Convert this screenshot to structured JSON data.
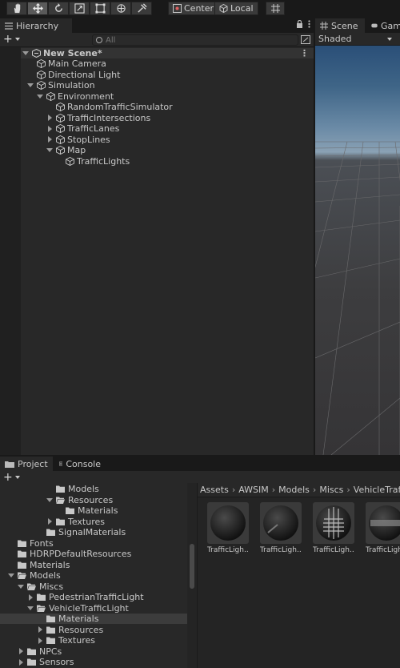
{
  "toolbar": {
    "tools": [
      "hand-tool",
      "move-tool",
      "rotate-tool",
      "scale-tool",
      "rect-tool",
      "transform-tool",
      "custom-tool"
    ],
    "active_tool": "move-tool",
    "pivot_label": "Center",
    "space_label": "Local"
  },
  "hierarchy": {
    "tab_label": "Hierarchy",
    "search_placeholder": "All",
    "scene_name": "New Scene*",
    "items": [
      {
        "label": "Main Camera",
        "depth": 1,
        "arrow": "none"
      },
      {
        "label": "Directional Light",
        "depth": 1,
        "arrow": "none"
      },
      {
        "label": "Simulation",
        "depth": 1,
        "arrow": "down"
      },
      {
        "label": "Environment",
        "depth": 2,
        "arrow": "down"
      },
      {
        "label": "RandomTrafficSimulator",
        "depth": 3,
        "arrow": "none"
      },
      {
        "label": "TrafficIntersections",
        "depth": 3,
        "arrow": "right"
      },
      {
        "label": "TrafficLanes",
        "depth": 3,
        "arrow": "right"
      },
      {
        "label": "StopLines",
        "depth": 3,
        "arrow": "right"
      },
      {
        "label": "Map",
        "depth": 3,
        "arrow": "down"
      },
      {
        "label": "TrafficLights",
        "depth": 4,
        "arrow": "none"
      }
    ]
  },
  "scene_view": {
    "tab_scene": "Scene",
    "tab_game": "Gam",
    "shading_mode": "Shaded"
  },
  "project": {
    "tab_project": "Project",
    "tab_console": "Console",
    "tree": [
      {
        "label": "Models",
        "depth": 6,
        "arrow": "none",
        "open": false
      },
      {
        "label": "Resources",
        "depth": 6,
        "arrow": "down",
        "open": true
      },
      {
        "label": "Materials",
        "depth": 7,
        "arrow": "none",
        "open": false
      },
      {
        "label": "Textures",
        "depth": 6,
        "arrow": "right",
        "open": false
      },
      {
        "label": "SignalMaterials",
        "depth": 5,
        "arrow": "none",
        "open": false
      },
      {
        "label": "Fonts",
        "depth": 2,
        "arrow": "none",
        "open": false
      },
      {
        "label": "HDRPDefaultResources",
        "depth": 2,
        "arrow": "none",
        "open": false
      },
      {
        "label": "Materials",
        "depth": 2,
        "arrow": "none",
        "open": false
      },
      {
        "label": "Models",
        "depth": 2,
        "arrow": "down",
        "open": true
      },
      {
        "label": "Miscs",
        "depth": 3,
        "arrow": "down",
        "open": true
      },
      {
        "label": "PedestrianTrafficLight",
        "depth": 4,
        "arrow": "right",
        "open": false
      },
      {
        "label": "VehicleTrafficLight",
        "depth": 4,
        "arrow": "down",
        "open": true
      },
      {
        "label": "Materials",
        "depth": 5,
        "arrow": "none",
        "open": false,
        "selected": true
      },
      {
        "label": "Resources",
        "depth": 5,
        "arrow": "right",
        "open": false
      },
      {
        "label": "Textures",
        "depth": 5,
        "arrow": "right",
        "open": false
      },
      {
        "label": "NPCs",
        "depth": 3,
        "arrow": "right",
        "open": false
      },
      {
        "label": "Sensors",
        "depth": 3,
        "arrow": "right",
        "open": false
      }
    ],
    "breadcrumb": [
      "Assets",
      "AWSIM",
      "Models",
      "Miscs",
      "VehicleTraffic"
    ],
    "assets": [
      {
        "label": "TrafficLigh...",
        "variant": "plain"
      },
      {
        "label": "TrafficLigh...",
        "variant": "stripe"
      },
      {
        "label": "TrafficLigh...",
        "variant": "grid"
      },
      {
        "label": "TrafficLigh...",
        "variant": "band"
      }
    ]
  },
  "colors": {
    "panel_bg": "#282828",
    "chrome_bg": "#191919",
    "scene_row_bg": "#333333",
    "selection_bg": "#3c3c3c",
    "text": "#c8c8c8"
  }
}
